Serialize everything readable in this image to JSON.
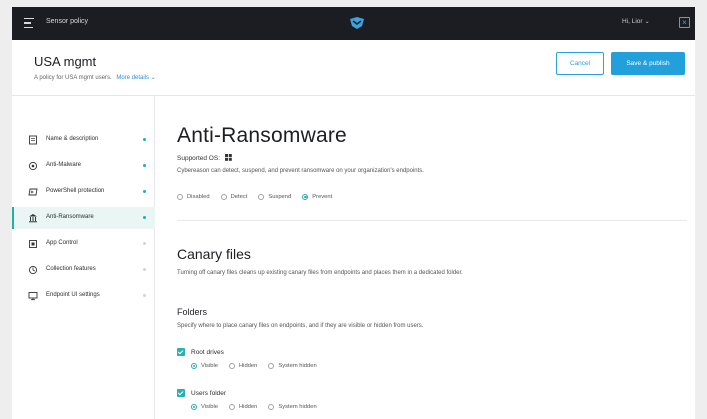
{
  "topbar": {
    "title": "Sensor policy",
    "user": "Hi, Lior",
    "logo_icon": "cybereason-logo-icon",
    "menu_icon": "hamburger-menu-icon",
    "close_icon": "close-icon"
  },
  "header": {
    "policy_name": "USA mgmt",
    "policy_desc": "A policy for USA mgmt users.",
    "more_details": "More details",
    "cancel": "Cancel",
    "save": "Save & publish"
  },
  "sidebar": {
    "items": [
      {
        "label": "Name & description",
        "icon": "document-icon",
        "status": "on"
      },
      {
        "label": "Anti-Malware",
        "icon": "shield-gear-icon",
        "status": "on"
      },
      {
        "label": "PowerShell protection",
        "icon": "powershell-icon",
        "status": "on"
      },
      {
        "label": "Anti-Ransomware",
        "icon": "bank-icon",
        "status": "on",
        "active": true
      },
      {
        "label": "App Control",
        "icon": "app-control-icon",
        "status": "off"
      },
      {
        "label": "Collection features",
        "icon": "collection-icon",
        "status": "off"
      },
      {
        "label": "Endpoint UI settings",
        "icon": "monitor-icon",
        "status": "off"
      }
    ]
  },
  "main": {
    "title": "Anti-Ransomware",
    "supported_os": "Supported OS:",
    "description": "Cybereason can detect, suspend, and prevent ransomware on your organization's endpoints.",
    "modes": [
      "Disabled",
      "Detect",
      "Suspend",
      "Prevent"
    ],
    "selected_mode": "Prevent",
    "canary": {
      "title": "Canary files",
      "description": "Turning off canary files cleans up existing canary files from endpoints and places them in a dedicated folder.",
      "folders_title": "Folders",
      "folders_desc": "Specify where to place canary files on endpoints, and if they are visible or hidden from users.",
      "folders": [
        {
          "label": "Root drives",
          "checked": true,
          "options": [
            "Visible",
            "Hidden",
            "System hidden"
          ],
          "selected": "Visible"
        },
        {
          "label": "Users folder",
          "checked": true,
          "options": [
            "Visible",
            "Hidden",
            "System hidden"
          ],
          "selected": "Visible"
        }
      ]
    }
  },
  "colors": {
    "accent": "#22a0dc",
    "teal": "#25b2b0",
    "topbar_bg": "#1b1d22"
  }
}
